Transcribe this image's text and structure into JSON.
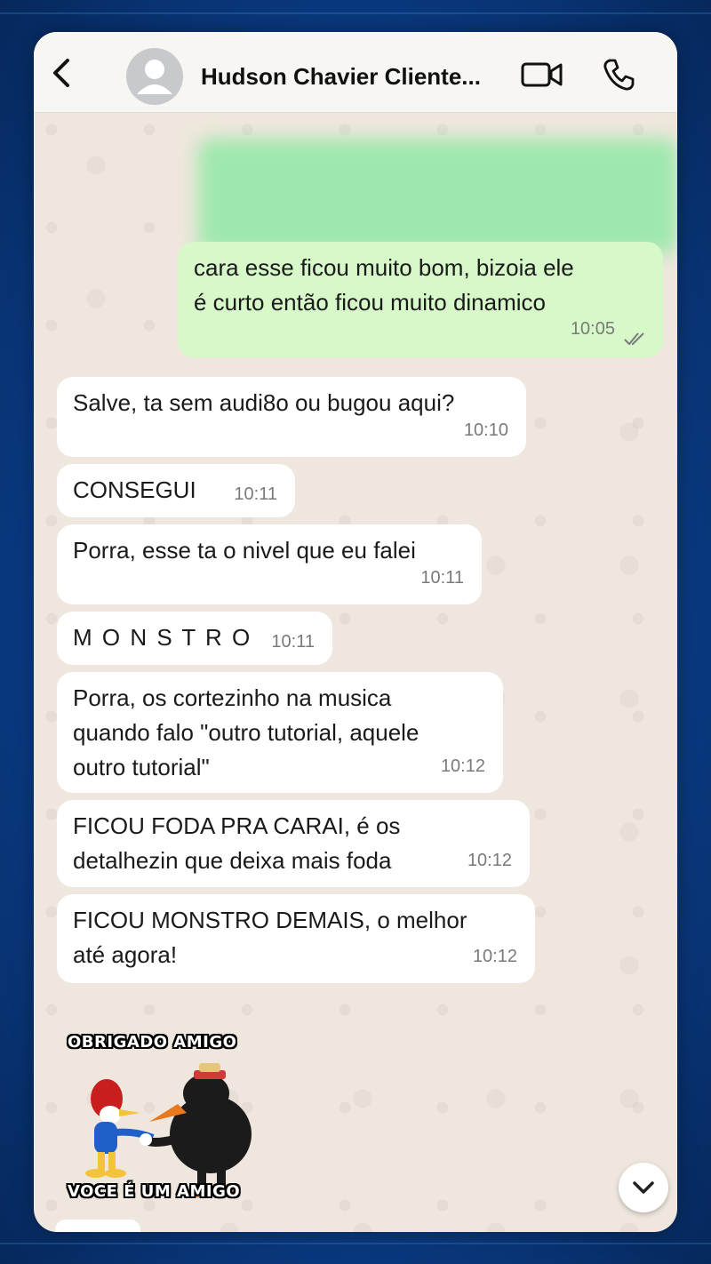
{
  "header": {
    "back_icon": "chevron-left-icon",
    "contact_name": "Hudson Chavier Cliente...",
    "video_icon": "video-camera-icon",
    "call_icon": "phone-icon"
  },
  "messages": [
    {
      "dir": "out",
      "text": "cara esse ficou muito bom, bizoia ele\né curto então ficou muito dinamico",
      "time": "10:05",
      "status": "read"
    },
    {
      "dir": "in",
      "text": "Salve, ta sem audi8o ou bugou aqui?",
      "time": "10:10"
    },
    {
      "dir": "in",
      "text": "CONSEGUI",
      "time": "10:11"
    },
    {
      "dir": "in",
      "text": "Porra, esse ta o nivel que eu falei",
      "time": "10:11"
    },
    {
      "dir": "in",
      "text": "M O N S T R O",
      "time": "10:11"
    },
    {
      "dir": "in",
      "text": "Porra, os cortezinho na musica\nquando falo \"outro tutorial, aquele\noutro tutorial\"",
      "time": "10:12"
    },
    {
      "dir": "in",
      "text": "FICOU FODA PRA CARAI, é os\ndetalhezin que deixa mais foda",
      "time": "10:12"
    },
    {
      "dir": "in",
      "text": "FICOU MONSTRO DEMAIS, o melhor\naté agora!",
      "time": "10:12"
    }
  ],
  "sticker": {
    "top_text": "OBRIGADO AMIGO",
    "bottom_text": "VOCE É UM AMIGO"
  },
  "colors": {
    "outgoing_bubble": "#d7f8c8",
    "incoming_bubble": "#ffffff",
    "chat_bg": "#efe7dd",
    "read_ticks": "#7a7a7a"
  }
}
